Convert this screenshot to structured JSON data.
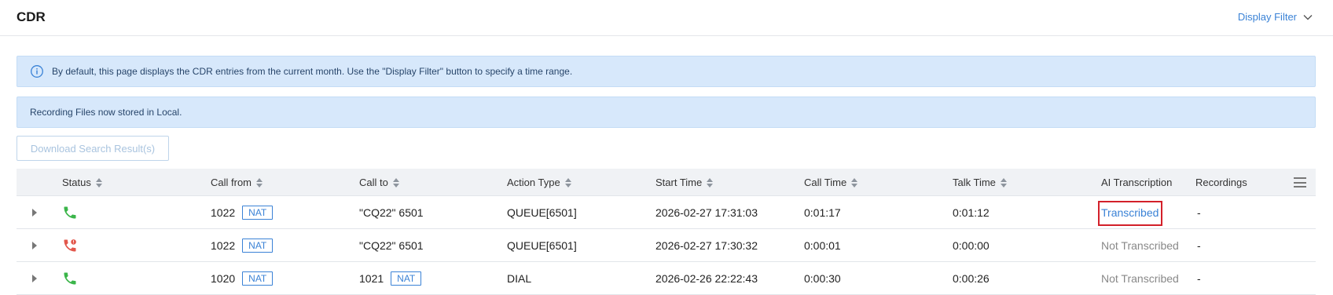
{
  "header": {
    "title": "CDR",
    "display_filter_label": "Display Filter"
  },
  "banners": {
    "info_text": "By default, this page displays the CDR entries from the current month. Use the \"Display Filter\" button to specify a time range.",
    "storage_text": "Recording Files now stored in Local."
  },
  "toolbar": {
    "download_label": "Download Search Result(s)"
  },
  "table": {
    "columns": {
      "status": "Status",
      "call_from": "Call from",
      "call_to": "Call to",
      "action_type": "Action Type",
      "start_time": "Start Time",
      "call_time": "Call Time",
      "talk_time": "Talk Time",
      "ai_transcription": "AI Transcription",
      "recordings": "Recordings"
    },
    "rows": [
      {
        "status_icon": "phone-answered-icon",
        "call_from": "1022",
        "call_from_tag": "NAT",
        "call_to": "\"CQ22\" 6501",
        "call_to_tag": "",
        "action_type": "QUEUE[6501]",
        "start_time": "2026-02-27 17:31:03",
        "call_time": "0:01:17",
        "talk_time": "0:01:12",
        "ai_transcription": "Transcribed",
        "recordings": "-"
      },
      {
        "status_icon": "phone-missed-icon",
        "call_from": "1022",
        "call_from_tag": "NAT",
        "call_to": "\"CQ22\" 6501",
        "call_to_tag": "",
        "action_type": "QUEUE[6501]",
        "start_time": "2026-02-27 17:30:32",
        "call_time": "0:00:01",
        "talk_time": "0:00:00",
        "ai_transcription": "Not Transcribed",
        "recordings": "-"
      },
      {
        "status_icon": "phone-answered-icon",
        "call_from": "1020",
        "call_from_tag": "NAT",
        "call_to": "1021",
        "call_to_tag": "NAT",
        "action_type": "DIAL",
        "start_time": "2026-02-26 22:22:43",
        "call_time": "0:00:30",
        "talk_time": "0:00:26",
        "ai_transcription": "Not Transcribed",
        "recordings": "-"
      }
    ]
  },
  "colors": {
    "accent": "#3a82d6",
    "answered": "#3bb54a",
    "missed": "#e2574c",
    "highlight_box": "#d3202a"
  }
}
